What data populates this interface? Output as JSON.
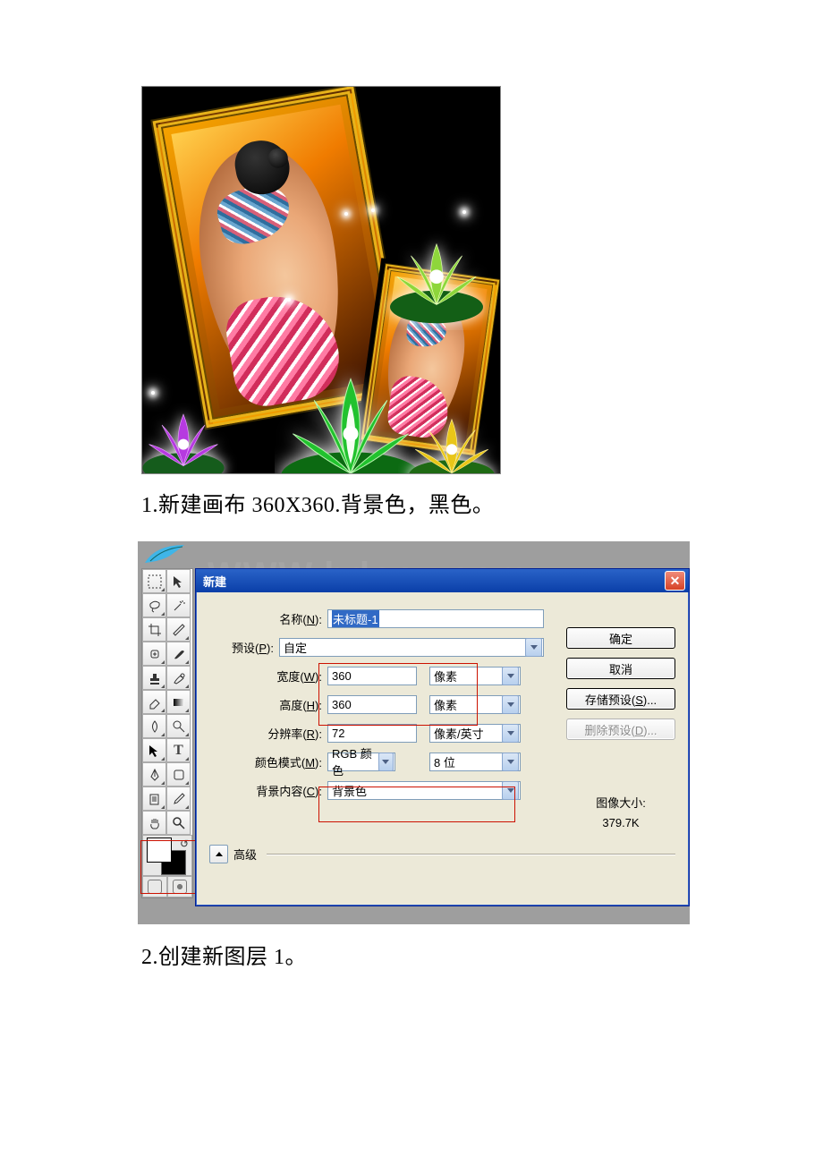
{
  "steps": {
    "one": "1.新建画布 360X360.背景色，黑色。",
    "two": "2.创建新图层 1。"
  },
  "watermark": "WWW.bdocx.com",
  "dialog": {
    "title": "新建",
    "close": "✕",
    "name_label": "名称(N):",
    "name_value": "未标题-1",
    "preset_label": "预设(P):",
    "preset_value": "自定",
    "width_label": "宽度(W):",
    "width_value": "360",
    "width_unit": "像素",
    "height_label": "高度(H):",
    "height_value": "360",
    "height_unit": "像素",
    "res_label": "分辨率(R):",
    "res_value": "72",
    "res_unit": "像素/英寸",
    "mode_label": "颜色模式(M):",
    "mode_value": "RGB 颜色",
    "depth_value": "8 位",
    "bg_label": "背景内容(C):",
    "bg_value": "背景色",
    "advanced": "高级",
    "ok": "确定",
    "cancel": "取消",
    "save_preset": "存储预设(S)...",
    "del_preset": "删除预设(D)...",
    "imgsize_label": "图像大小:",
    "imgsize_value": "379.7K"
  },
  "tools": {
    "items": [
      "marquee",
      "move",
      "lasso",
      "wand",
      "crop",
      "slice",
      "heal",
      "brush",
      "stamp",
      "history",
      "eraser",
      "gradient",
      "blur",
      "dodge",
      "path",
      "type",
      "pen",
      "shape",
      "notes",
      "eyedrop",
      "hand",
      "zoom"
    ]
  }
}
